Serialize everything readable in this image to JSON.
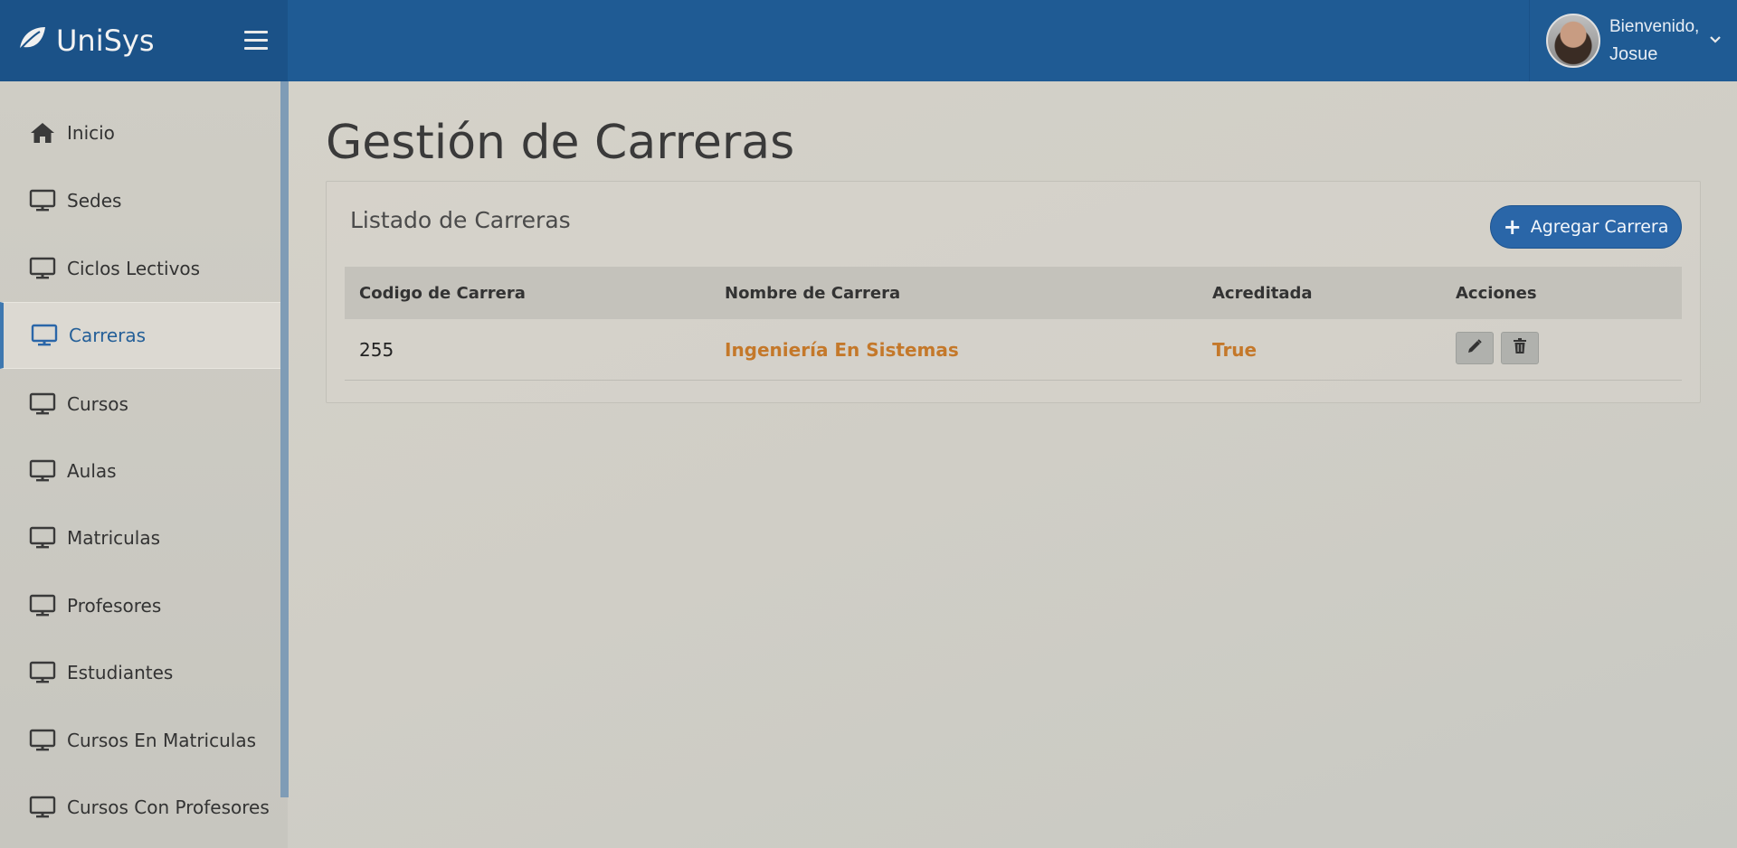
{
  "app": {
    "name": "UniSys"
  },
  "user": {
    "greeting": "Bienvenido,",
    "name": "Josue"
  },
  "sidebar": {
    "items": [
      {
        "label": "Inicio",
        "icon": "home-icon"
      },
      {
        "label": "Sedes",
        "icon": "monitor-icon"
      },
      {
        "label": "Ciclos Lectivos",
        "icon": "monitor-icon"
      },
      {
        "label": "Carreras",
        "icon": "monitor-icon",
        "active": true
      },
      {
        "label": "Cursos",
        "icon": "monitor-icon"
      },
      {
        "label": "Aulas",
        "icon": "monitor-icon"
      },
      {
        "label": "Matriculas",
        "icon": "monitor-icon"
      },
      {
        "label": "Profesores",
        "icon": "monitor-icon"
      },
      {
        "label": "Estudiantes",
        "icon": "monitor-icon"
      },
      {
        "label": "Cursos En Matriculas",
        "icon": "monitor-icon"
      },
      {
        "label": "Cursos Con Profesores",
        "icon": "monitor-icon"
      }
    ]
  },
  "main": {
    "title": "Gestión de Carreras",
    "panel_title": "Listado de Carreras",
    "add_button": "Agregar Carrera",
    "table": {
      "headers": [
        "Codigo de Carrera",
        "Nombre de Carrera",
        "Acreditada",
        "Acciones"
      ],
      "rows": [
        {
          "codigo": "255",
          "nombre": "Ingeniería En Sistemas",
          "acreditada": "True"
        }
      ]
    }
  },
  "colors": {
    "topbar": "#1f5b94",
    "accent": "#2a66a8",
    "link": "#c4782a",
    "active_nav": "#245f98"
  }
}
